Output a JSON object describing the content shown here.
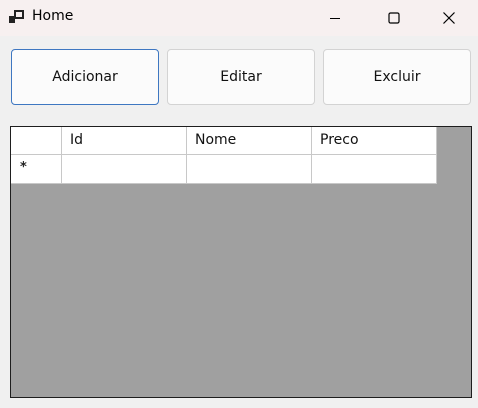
{
  "window": {
    "title": "Home",
    "app_icon": "app-window-icon",
    "controls": [
      "minimize-icon",
      "maximize-icon",
      "close-icon"
    ]
  },
  "toolbar": {
    "add_label": "Adicionar",
    "edit_label": "Editar",
    "delete_label": "Excluir"
  },
  "grid": {
    "columns": [
      "Id",
      "Nome",
      "Preco"
    ],
    "new_row_marker": "*",
    "rows": []
  },
  "colors": {
    "grid_background": "#a0a0a0",
    "primary_border": "#3e77c1"
  }
}
